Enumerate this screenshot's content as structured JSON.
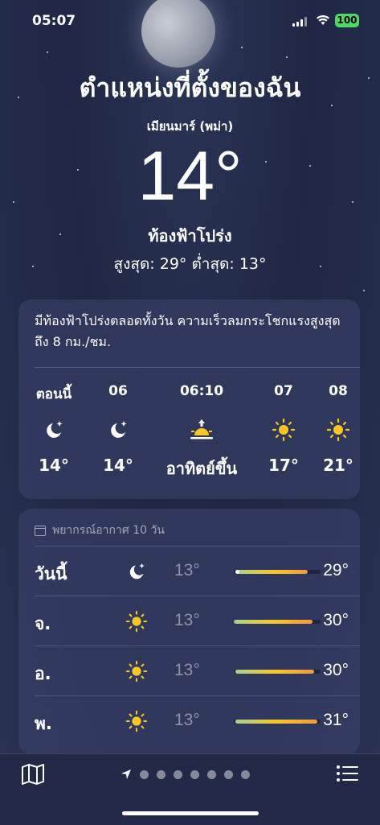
{
  "status": {
    "time": "05:07",
    "battery": "100"
  },
  "header": {
    "location": "ตำแหน่งที่ตั้งของฉัน",
    "sublocation": "เมียนมาร์ (พม่า)",
    "temperature": "14°",
    "condition": "ท้องฟ้าโปร่ง",
    "hilo": "สูงสุด: 29°  ต่ำสุด: 13°"
  },
  "hourly": {
    "summary": "มีท้องฟ้าโปร่งตลอดทั้งวัน ความเร็วลมกระโชกแรงสูงสุดถึง 8 กม./ชม.",
    "items": [
      {
        "label": "ตอนนี้",
        "icon": "moon-stars-icon",
        "temp": "14°"
      },
      {
        "label": "06",
        "icon": "moon-stars-icon",
        "temp": "14°"
      },
      {
        "label": "06:10",
        "icon": "sunrise-icon",
        "temp": "อาทิตย์ขึ้น"
      },
      {
        "label": "07",
        "icon": "sun-icon",
        "temp": "17°"
      },
      {
        "label": "08",
        "icon": "sun-icon",
        "temp": "21°"
      }
    ]
  },
  "forecast": {
    "title": "พยากรณ์อากาศ 10 วัน",
    "days": [
      {
        "name": "วันนี้",
        "icon": "moon-stars-icon",
        "low": "13°",
        "high": "29°"
      },
      {
        "name": "จ.",
        "icon": "sun-icon",
        "low": "13°",
        "high": "30°"
      },
      {
        "name": "อ.",
        "icon": "sun-icon",
        "low": "13°",
        "high": "30°"
      },
      {
        "name": "พ.",
        "icon": "sun-icon",
        "low": "13°",
        "high": "31°"
      }
    ]
  },
  "colors": {
    "sun": "#f9c626",
    "bar_green": "#a8d08d",
    "bar_orange": "#f19a3e"
  }
}
